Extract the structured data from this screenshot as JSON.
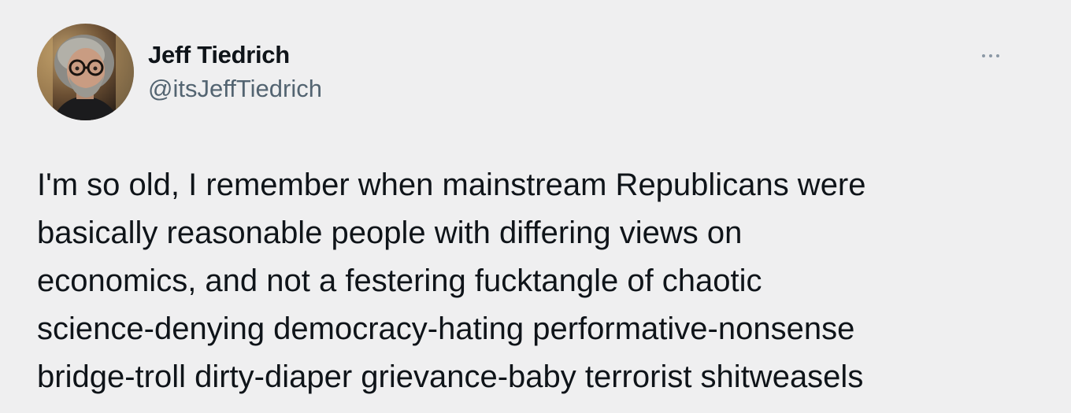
{
  "author": {
    "display_name": "Jeff Tiedrich",
    "handle": "@itsJeffTiedrich",
    "avatar_icon": "profile-photo"
  },
  "more_menu": {
    "icon": "more-horizontal-icon"
  },
  "tweet": {
    "lines": [
      "I'm so old, I remember when mainstream Republicans were",
      "basically reasonable people with differing views on",
      "economics, and not a festering fucktangle of chaotic",
      "science-denying democracy-hating performative-nonsense",
      "bridge-troll dirty-diaper grievance-baby terrorist shitweasels"
    ]
  },
  "colors": {
    "background": "#efeff0",
    "text": "#0f1419",
    "secondary_text": "#536471",
    "icon": "#8b98a5"
  }
}
